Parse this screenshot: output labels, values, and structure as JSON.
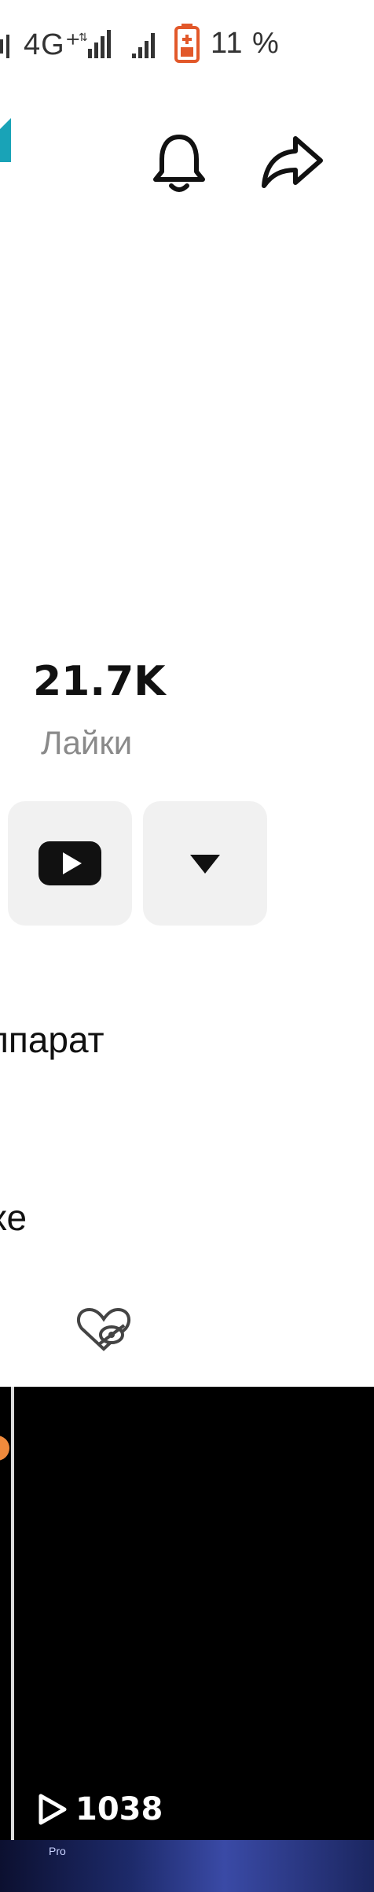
{
  "status_bar": {
    "network": "4G⁺",
    "battery_percent": "11 %"
  },
  "header": {
    "bell_icon": "bell-icon",
    "share_icon": "share-icon"
  },
  "stats": {
    "likes_value": "21.7K",
    "likes_label": "Лайки"
  },
  "actions": {
    "youtube_icon": "youtube-icon",
    "dropdown_icon": "caret-down-icon"
  },
  "bio": {
    "line1": "ппарат",
    "line2": "хе"
  },
  "tabs": {
    "liked_hidden_icon": "heart-hidden-icon"
  },
  "videos": [
    {
      "views": "1038"
    }
  ],
  "video_thumb_text": "Pro",
  "colors": {
    "accent": "#19a3b7",
    "battery": "#e2582a",
    "button_bg": "#f1f1f1"
  }
}
